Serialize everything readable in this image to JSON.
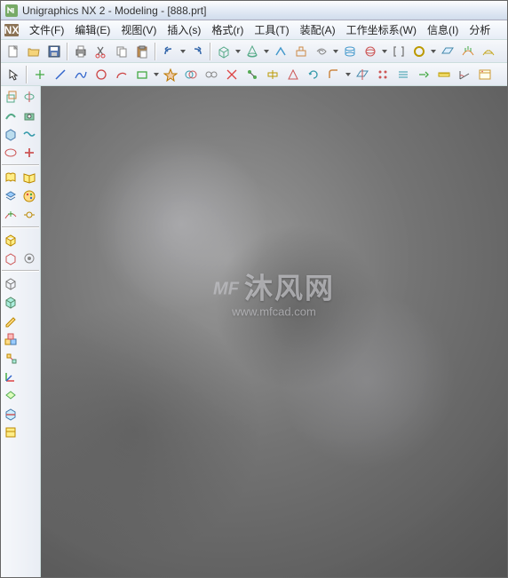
{
  "title": {
    "app": "Unigraphics NX 2 - Modeling - [888.prt]"
  },
  "menu": {
    "file": "文件(F)",
    "edit": "编辑(E)",
    "view": "视图(V)",
    "insert": "插入(s)",
    "format": "格式(r)",
    "tool": "工具(T)",
    "assembly": "装配(A)",
    "wcs": "工作坐标系(W)",
    "info": "信息(I)",
    "analyze": "分析"
  },
  "watermark": {
    "logo": "MF",
    "text": "沐风网",
    "url": "www.mfcad.com"
  }
}
